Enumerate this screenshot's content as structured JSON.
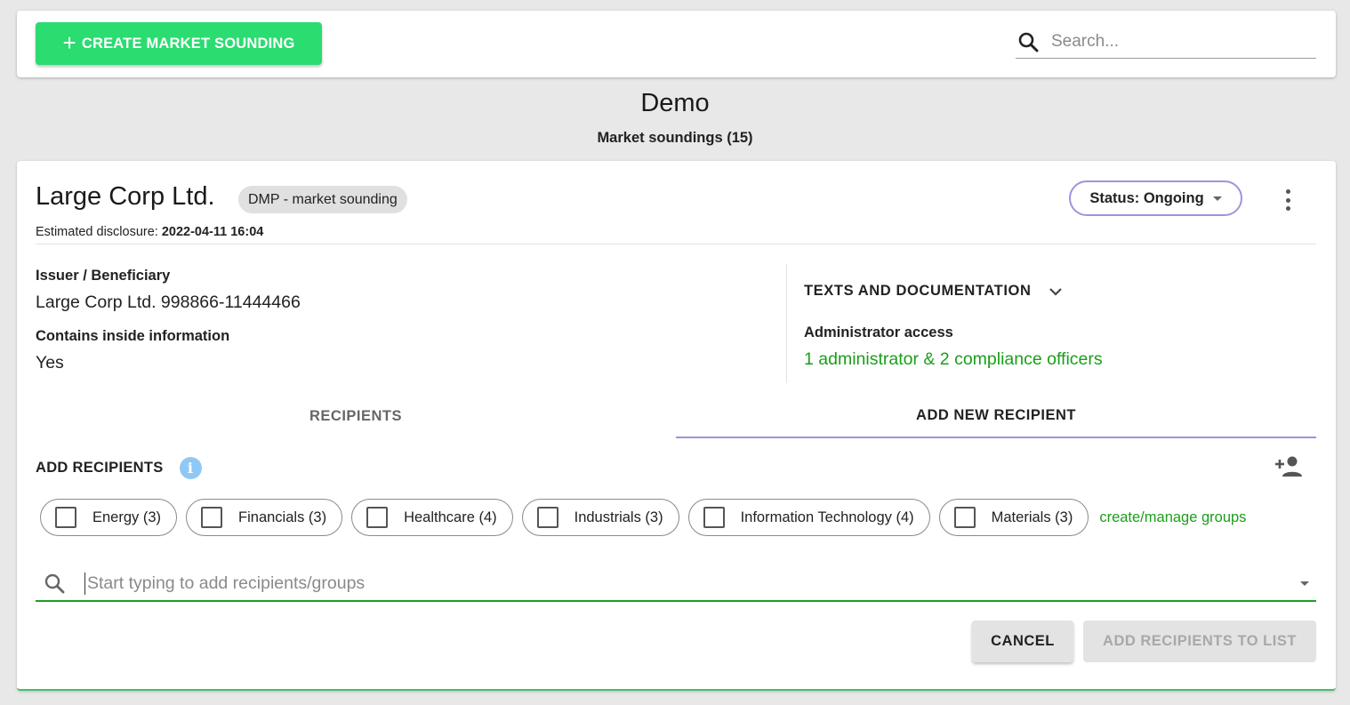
{
  "toolbar": {
    "create_label": "CREATE MARKET SOUNDING",
    "search_placeholder": "Search..."
  },
  "page": {
    "title": "Demo",
    "subtitle": "Market soundings (15)"
  },
  "sounding": {
    "company": "Large Corp Ltd.",
    "type_chip": "DMP - market sounding",
    "disclosure_label": "Estimated disclosure:",
    "disclosure_value": "2022-04-11 16:04",
    "status_label": "Status: Ongoing",
    "issuer_label": "Issuer / Beneficiary",
    "issuer_value": "Large Corp Ltd. 998866-11444466",
    "inside_label": "Contains inside information",
    "inside_value": "Yes",
    "texts_doc_label": "TEXTS AND DOCUMENTATION",
    "admin_label": "Administrator access",
    "admin_link": "1 administrator & 2 compliance officers"
  },
  "tabs": [
    {
      "label": "RECIPIENTS",
      "active": false
    },
    {
      "label": "ADD NEW RECIPIENT",
      "active": true
    }
  ],
  "add_recipients": {
    "title": "ADD RECIPIENTS",
    "groups": [
      {
        "label": "Energy (3)"
      },
      {
        "label": "Financials (3)"
      },
      {
        "label": "Healthcare (4)"
      },
      {
        "label": "Industrials (3)"
      },
      {
        "label": "Information Technology (4)"
      },
      {
        "label": "Materials (3)"
      }
    ],
    "manage_link": "create/manage groups",
    "search_placeholder": "Start typing to add recipients/groups",
    "cancel_label": "CANCEL",
    "add_label": "ADD RECIPIENTS TO LIST"
  },
  "colors": {
    "primary_green": "#2bdc70",
    "link_green": "#1a9e1a",
    "accent_purple": "#9c94e0"
  },
  "icons": {
    "search": "search-icon",
    "plus": "plus-icon",
    "info": "info-icon",
    "person_add": "person-add-icon",
    "kebab": "more-vertical-icon",
    "chevron": "chevron-down-icon"
  }
}
